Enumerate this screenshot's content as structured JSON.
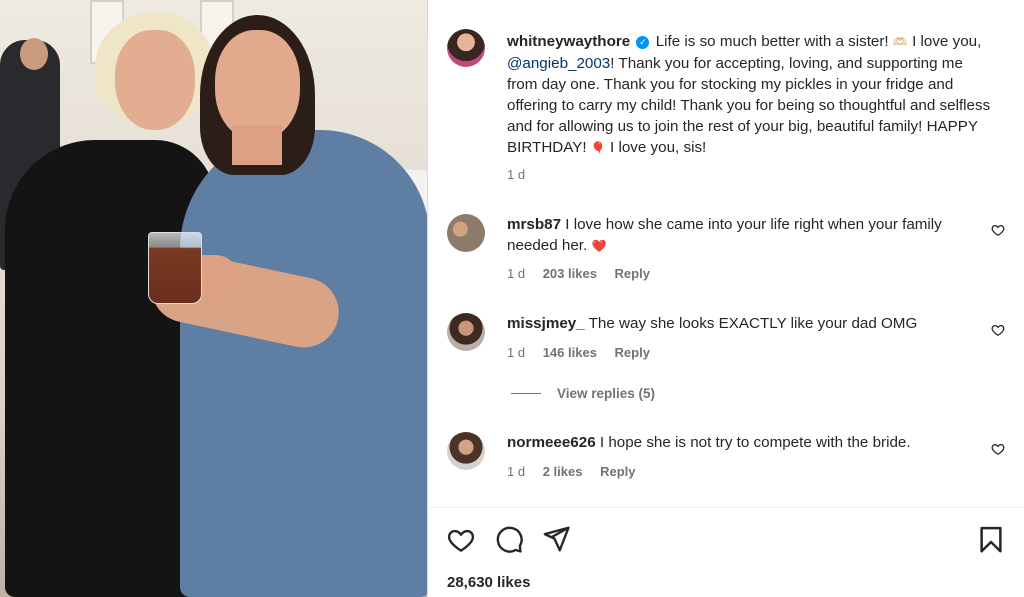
{
  "post": {
    "author": "whitneywaythore",
    "caption_parts": {
      "p1": "Life is so much better with a sister!",
      "hands_emoji": "🫶🏻",
      "p2": "I love you,",
      "mention": "@angieb_2003",
      "p3": "! Thank you for accepting, loving, and supporting me from day one. Thank you for stocking my pickles in your fridge and offering to carry my child! Thank you for being so thoughtful and selfless and for allowing us to join the rest of your big, beautiful family! HAPPY BIRTHDAY!",
      "balloon_emoji": "🎈",
      "p4": "I love you, sis!"
    },
    "time": "1 d",
    "likes": "28,630 likes"
  },
  "comments": [
    {
      "user": "mrsb87",
      "text": "I love how she came into your life right when your family needed her.",
      "emoji": "❤️",
      "time": "1 d",
      "likes": "203 likes",
      "reply": "Reply"
    },
    {
      "user": "missjmey_",
      "text": "The way she looks EXACTLY like your dad OMG",
      "time": "1 d",
      "likes": "146 likes",
      "reply": "Reply"
    },
    {
      "user": "normeee626",
      "text": "I hope she is not try to compete with the bride.",
      "time": "1 d",
      "likes": "2 likes",
      "reply": "Reply"
    }
  ],
  "view_replies": "View replies (5)",
  "colors": {
    "mention": "#00376b",
    "verified": "#0095f6",
    "heart": "#ed4956",
    "muted": "#737373"
  },
  "icons": [
    "verified-icon",
    "heart-icon",
    "comment-icon",
    "share-icon",
    "bookmark-icon"
  ]
}
